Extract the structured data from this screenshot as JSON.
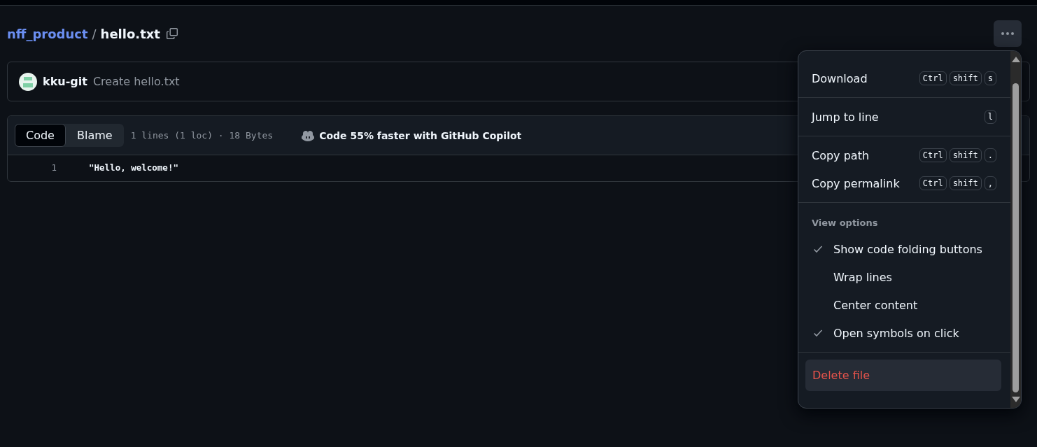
{
  "breadcrumb": {
    "repo": "nff_product",
    "separator": "/",
    "file": "hello.txt"
  },
  "commit": {
    "author": "kku-git",
    "message": "Create hello.txt"
  },
  "file_view": {
    "tabs": [
      {
        "label": "Code",
        "selected": true
      },
      {
        "label": "Blame",
        "selected": false
      }
    ],
    "stats": "1 lines (1 loc) · 18 Bytes",
    "copilot": "Code 55% faster with GitHub Copilot",
    "lines": [
      {
        "number": "1",
        "code": "\"Hello, welcome!\""
      }
    ]
  },
  "menu": {
    "sections": [
      {
        "items": [
          {
            "kind": "action",
            "label": "Download",
            "keys": [
              "Ctrl",
              "shift",
              "s"
            ]
          }
        ]
      },
      {
        "items": [
          {
            "kind": "action",
            "label": "Jump to line",
            "keys": [
              "l"
            ]
          }
        ]
      },
      {
        "items": [
          {
            "kind": "action",
            "label": "Copy path",
            "keys": [
              "Ctrl",
              "shift",
              "."
            ]
          },
          {
            "kind": "action",
            "label": "Copy permalink",
            "keys": [
              "Ctrl",
              "shift",
              ","
            ]
          }
        ]
      },
      {
        "heading": "View options",
        "items": [
          {
            "kind": "option",
            "label": "Show code folding buttons",
            "checked": true
          },
          {
            "kind": "option",
            "label": "Wrap lines",
            "checked": false
          },
          {
            "kind": "option",
            "label": "Center content",
            "checked": false
          },
          {
            "kind": "option",
            "label": "Open symbols on click",
            "checked": true
          }
        ]
      },
      {
        "items": [
          {
            "kind": "danger",
            "label": "Delete file"
          }
        ]
      }
    ]
  }
}
